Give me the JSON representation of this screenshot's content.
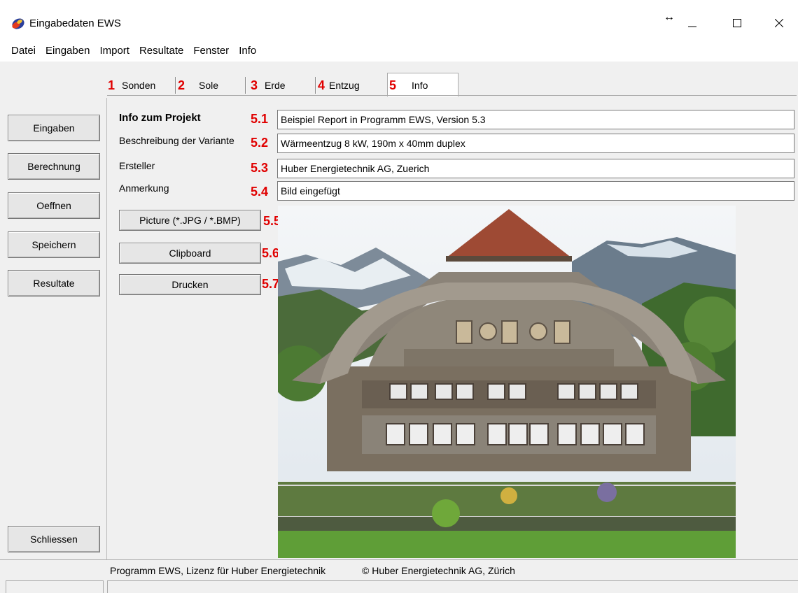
{
  "window": {
    "title": "Eingabedaten EWS"
  },
  "menu": [
    "Datei",
    "Eingaben",
    "Import",
    "Resultate",
    "Fenster",
    "Info"
  ],
  "tabs": [
    {
      "num": "1",
      "label": "Sonden"
    },
    {
      "num": "2",
      "label": "Sole"
    },
    {
      "num": "3",
      "label": "Erde"
    },
    {
      "num": "4",
      "label": "Entzug"
    },
    {
      "num": "5",
      "label": "Info"
    }
  ],
  "sidebar": {
    "buttons": [
      "Eingaben",
      "Berechnung",
      "Oeffnen",
      "Speichern",
      "Resultate"
    ],
    "close": "Schliessen"
  },
  "fields": [
    {
      "num": "5.1",
      "label": "Info zum Projekt",
      "value": "Beispiel Report in Programm EWS, Version 5.3"
    },
    {
      "num": "5.2",
      "label": "Beschreibung der Variante",
      "value": "Wärmeentzug 8 kW, 190m x 40mm duplex"
    },
    {
      "num": "5.3",
      "label": "Ersteller",
      "value": "Huber Energietechnik AG, Zuerich"
    },
    {
      "num": "5.4",
      "label": "Anmerkung",
      "value": "Bild eingefügt"
    }
  ],
  "actions": [
    {
      "num": "5.5",
      "label": "Picture  (*.JPG / *.BMP)"
    },
    {
      "num": "5.6",
      "label": "Clipboard"
    },
    {
      "num": "5.7",
      "label": "Drucken"
    }
  ],
  "status": {
    "license": "Programm EWS, Lizenz für Huber Energietechnik",
    "copyright": "© Huber Energietechnik AG, Zürich"
  },
  "colors": {
    "accent_red": "#e00000",
    "window_bg": "#f0f0f0"
  }
}
